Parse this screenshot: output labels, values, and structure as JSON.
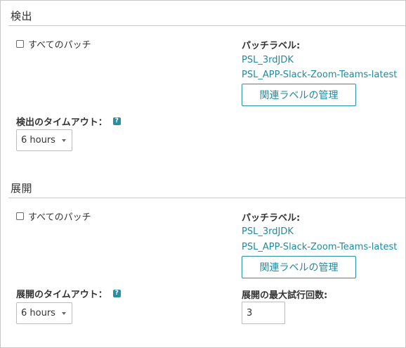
{
  "colors": {
    "accent": "#1e8aa0",
    "border": "#c8c8c8",
    "text": "#333333"
  },
  "detection": {
    "title": "検出",
    "all_patches_label": "すべてのパッチ",
    "patch_labels_heading": "パッチラベル:",
    "patch_labels": [
      "PSL_3rdJDK",
      "PSL_APP-Slack-Zoom-Teams-latest"
    ],
    "manage_button": "関連ラベルの管理",
    "timeout_label": "検出のタイムアウト：",
    "timeout_value": "6 hours"
  },
  "deployment": {
    "title": "展開",
    "all_patches_label": "すべてのパッチ",
    "patch_labels_heading": "パッチラベル:",
    "patch_labels": [
      "PSL_3rdJDK",
      "PSL_APP-Slack-Zoom-Teams-latest"
    ],
    "manage_button": "関連ラベルの管理",
    "timeout_label": "展開のタイムアウト：",
    "timeout_value": "6 hours",
    "max_attempts_label": "展開の最大試行回数:",
    "max_attempts_value": "3"
  },
  "icons": {
    "help": "help-icon",
    "dropdown": "chevron-down-icon"
  },
  "help_glyph": "?"
}
